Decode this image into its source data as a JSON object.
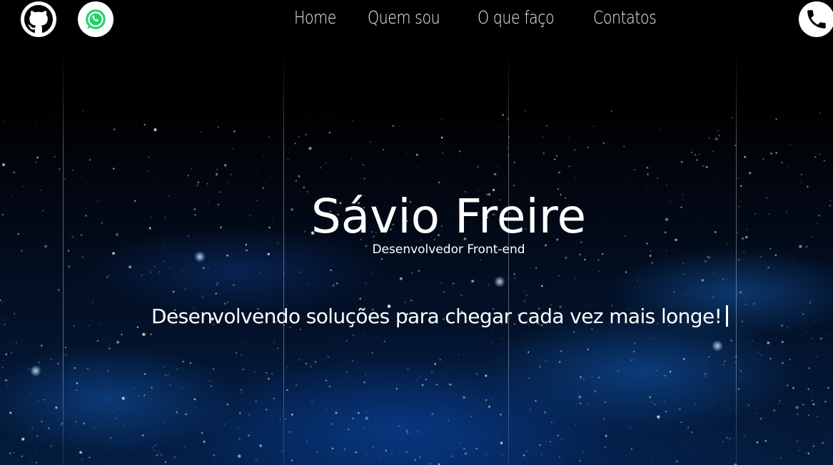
{
  "nav": {
    "items": [
      {
        "label": "Home"
      },
      {
        "label": "Quem sou"
      },
      {
        "label": "O que faço"
      },
      {
        "label": "Contatos"
      }
    ]
  },
  "social": {
    "github_icon": "github-icon",
    "whatsapp_icon": "whatsapp-icon",
    "phone_icon": "phone-icon"
  },
  "hero": {
    "name": "Sávio Freire",
    "role": "Desenvolvedor Front-end",
    "tagline": "Desenvolvendo soluções para chegar cada vez mais longe!"
  },
  "colors": {
    "background": "#000000",
    "nebula_blue": "#0a4aa0",
    "text": "#ffffff",
    "whatsapp_green": "#25d366"
  }
}
